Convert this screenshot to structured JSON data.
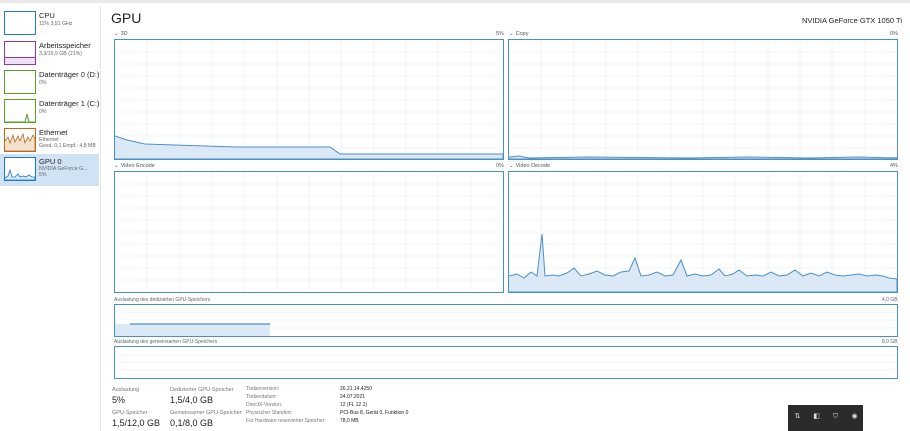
{
  "sidebar": {
    "items": [
      {
        "name": "CPU",
        "sub1": "11% 3,51 GHz",
        "sub2": "",
        "sub3": "",
        "color": "#1e78c8"
      },
      {
        "name": "Arbeitsspeicher",
        "sub1": "3,3/15,9 GB (21%)",
        "sub2": "",
        "sub3": "",
        "color": "#8b3a9e"
      },
      {
        "name": "Datenträger 0 (D:)",
        "sub1": "0%",
        "sub2": "",
        "sub3": "",
        "color": "#5aa02c"
      },
      {
        "name": "Datenträger 1 (C:)",
        "sub1": "0%",
        "sub2": "",
        "sub3": "",
        "color": "#5aa02c"
      },
      {
        "name": "Ethernet",
        "sub1": "Ethernet",
        "sub2": "Gesd. 0,1 Empf.: 4,8 MB",
        "sub3": "",
        "color": "#b96a1e"
      },
      {
        "name": "GPU 0",
        "sub1": "NVIDIA GeForce G...",
        "sub2": "5%",
        "sub3": "",
        "color": "#1e78c8"
      }
    ]
  },
  "header": {
    "title": "GPU",
    "device": "NVIDIA GeForce GTX 1050 Ti"
  },
  "graphs": [
    {
      "label": "3D",
      "pct": "5%"
    },
    {
      "label": "Copy",
      "pct": "0%"
    },
    {
      "label": "Video Encode",
      "pct": "0%"
    },
    {
      "label": "Video Decode",
      "pct": "4%"
    }
  ],
  "memory": {
    "dedicated": {
      "label": "Auslastung des dedizierten GPU-Speichers",
      "max": "4,0 GB"
    },
    "shared": {
      "label": "Auslastung des gemeinsamen GPU-Speichers",
      "max": "8,0 GB"
    }
  },
  "stats": {
    "auslastung": {
      "label": "Auslastung",
      "value": "5%"
    },
    "dedicated_mem": {
      "label": "Dedizierter GPU-Speicher",
      "value": "1,5/4,0 GB"
    },
    "gpu_mem": {
      "label": "GPU-Speicher",
      "value": "1,5/12,0 GB"
    },
    "shared_mem": {
      "label": "Gemeinsamer GPU-Speicher",
      "value": "0,1/8,0 GB"
    }
  },
  "properties": [
    {
      "label": "Treiberversion:",
      "value": "26.21.14.4250"
    },
    {
      "label": "Treiberdatum:",
      "value": "24.07.2021"
    },
    {
      "label": "DirectX-Version:",
      "value": "12 (FL 12.1)"
    },
    {
      "label": "Physischer Standort:",
      "value": "PCI-Bus 8, Gerät 0, Funktion 0"
    },
    {
      "label": "Für Hardware reservierter Speicher:",
      "value": "78,0 MB"
    }
  ],
  "tray": {
    "icons": [
      "network-icon",
      "speaker-icon",
      "shield-icon",
      "chat-icon"
    ]
  },
  "colors": {
    "accent": "#4a90c8",
    "fill": "#dbe9f6",
    "selected": "#cfe3f5"
  }
}
